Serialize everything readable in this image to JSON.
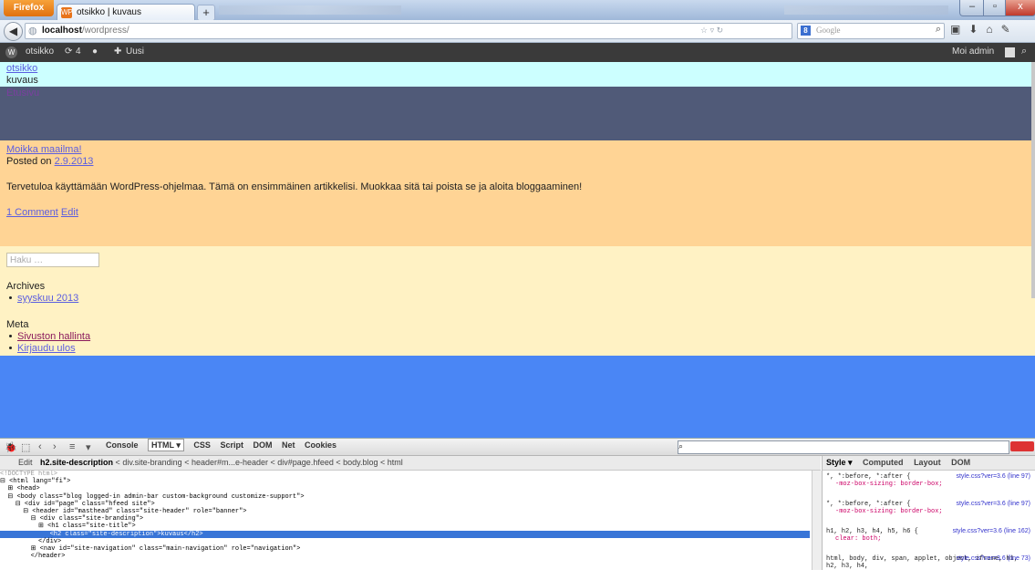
{
  "browser": {
    "menu_button": "Firefox",
    "tab_title": "otsikko | kuvaus",
    "tab_favicon": "WP",
    "new_tab": "+",
    "url_host": "localhost",
    "url_path": "/wordpress/",
    "search_placeholder": "Google",
    "window_controls": {
      "minimize": "–",
      "maximize": "▫",
      "close": "x"
    }
  },
  "admin_bar": {
    "site_name": "otsikko",
    "updates_count": "4",
    "new_label": "Uusi",
    "greeting": "Moi admin"
  },
  "site": {
    "title": "otsikko",
    "description": "kuvaus",
    "nav_item": "Etusivu"
  },
  "post": {
    "title": "Moikka maailma!",
    "posted_on": "Posted on",
    "date": "2.9.2013",
    "content": "Tervetuloa käyttämään WordPress-ohjelmaa. Tämä on ensimmäinen artikkelisi. Muokkaa sitä tai poista se ja aloita bloggaaminen!",
    "comments_link": "1 Comment",
    "edit_link": "Edit"
  },
  "sidebar": {
    "search_placeholder": "Haku …",
    "archives_heading": "Archives",
    "archives": [
      "syyskuu 2013"
    ],
    "meta_heading": "Meta",
    "meta_links": [
      "Sivuston hallinta",
      "Kirjaudu ulos"
    ]
  },
  "colors": {
    "header_bg": "#ccffff",
    "nav_bg": "#505a78",
    "article_bg": "#ffd495",
    "sidebar_bg": "#fff2c4",
    "footer_bg": "#4a86f5"
  },
  "firebug": {
    "tabs": [
      "Console",
      "HTML ▾",
      "CSS",
      "Script",
      "DOM",
      "Net",
      "Cookies"
    ],
    "edit": "Edit",
    "breadcrumb": [
      "h2.site-description",
      "div.site-branding",
      "header#m...e-header",
      "div#page.hfeed",
      "body.blog",
      "html"
    ],
    "html_lines": [
      "<!DOCTYPE html>",
      "⊟ <html lang=\"fi\">",
      "  ⊞ <head>",
      "  ⊟ <body class=\"blog logged-in admin-bar custom-background customize-support\">",
      "    ⊟ <div id=\"page\" class=\"hfeed site\">",
      "      ⊟ <header id=\"masthead\" class=\"site-header\" role=\"banner\">",
      "        ⊟ <div class=\"site-branding\">",
      "          ⊞ <h1 class=\"site-title\">",
      "             <h2 class=\"site-description\">kuvaus</h2>",
      "          </div>",
      "        ⊞ <nav id=\"site-navigation\" class=\"main-navigation\" role=\"navigation\">",
      "        </header>"
    ],
    "side_tabs": [
      "Style ▾",
      "Computed",
      "Layout",
      "DOM"
    ],
    "rules": [
      {
        "selector": "*, *:before, *:after {",
        "prop": "-moz-box-sizing: border-box;",
        "source": "style.css?ver=3.6 (line 97)"
      },
      {
        "selector": "*, *:before, *:after {",
        "prop": "-moz-box-sizing: border-box;",
        "source": "style.css?ver=3.6 (line 97)"
      },
      {
        "selector": "h1, h2, h3, h4, h5, h6 {",
        "prop": "clear: both;",
        "source": "style.css?ver=3.6 (line 162)"
      },
      {
        "selector": "html, body, div, span, applet, object, iframe, h1, h2, h3, h4,",
        "prop": "",
        "source": "style.css?ver=3.6 (line 73)"
      }
    ]
  }
}
